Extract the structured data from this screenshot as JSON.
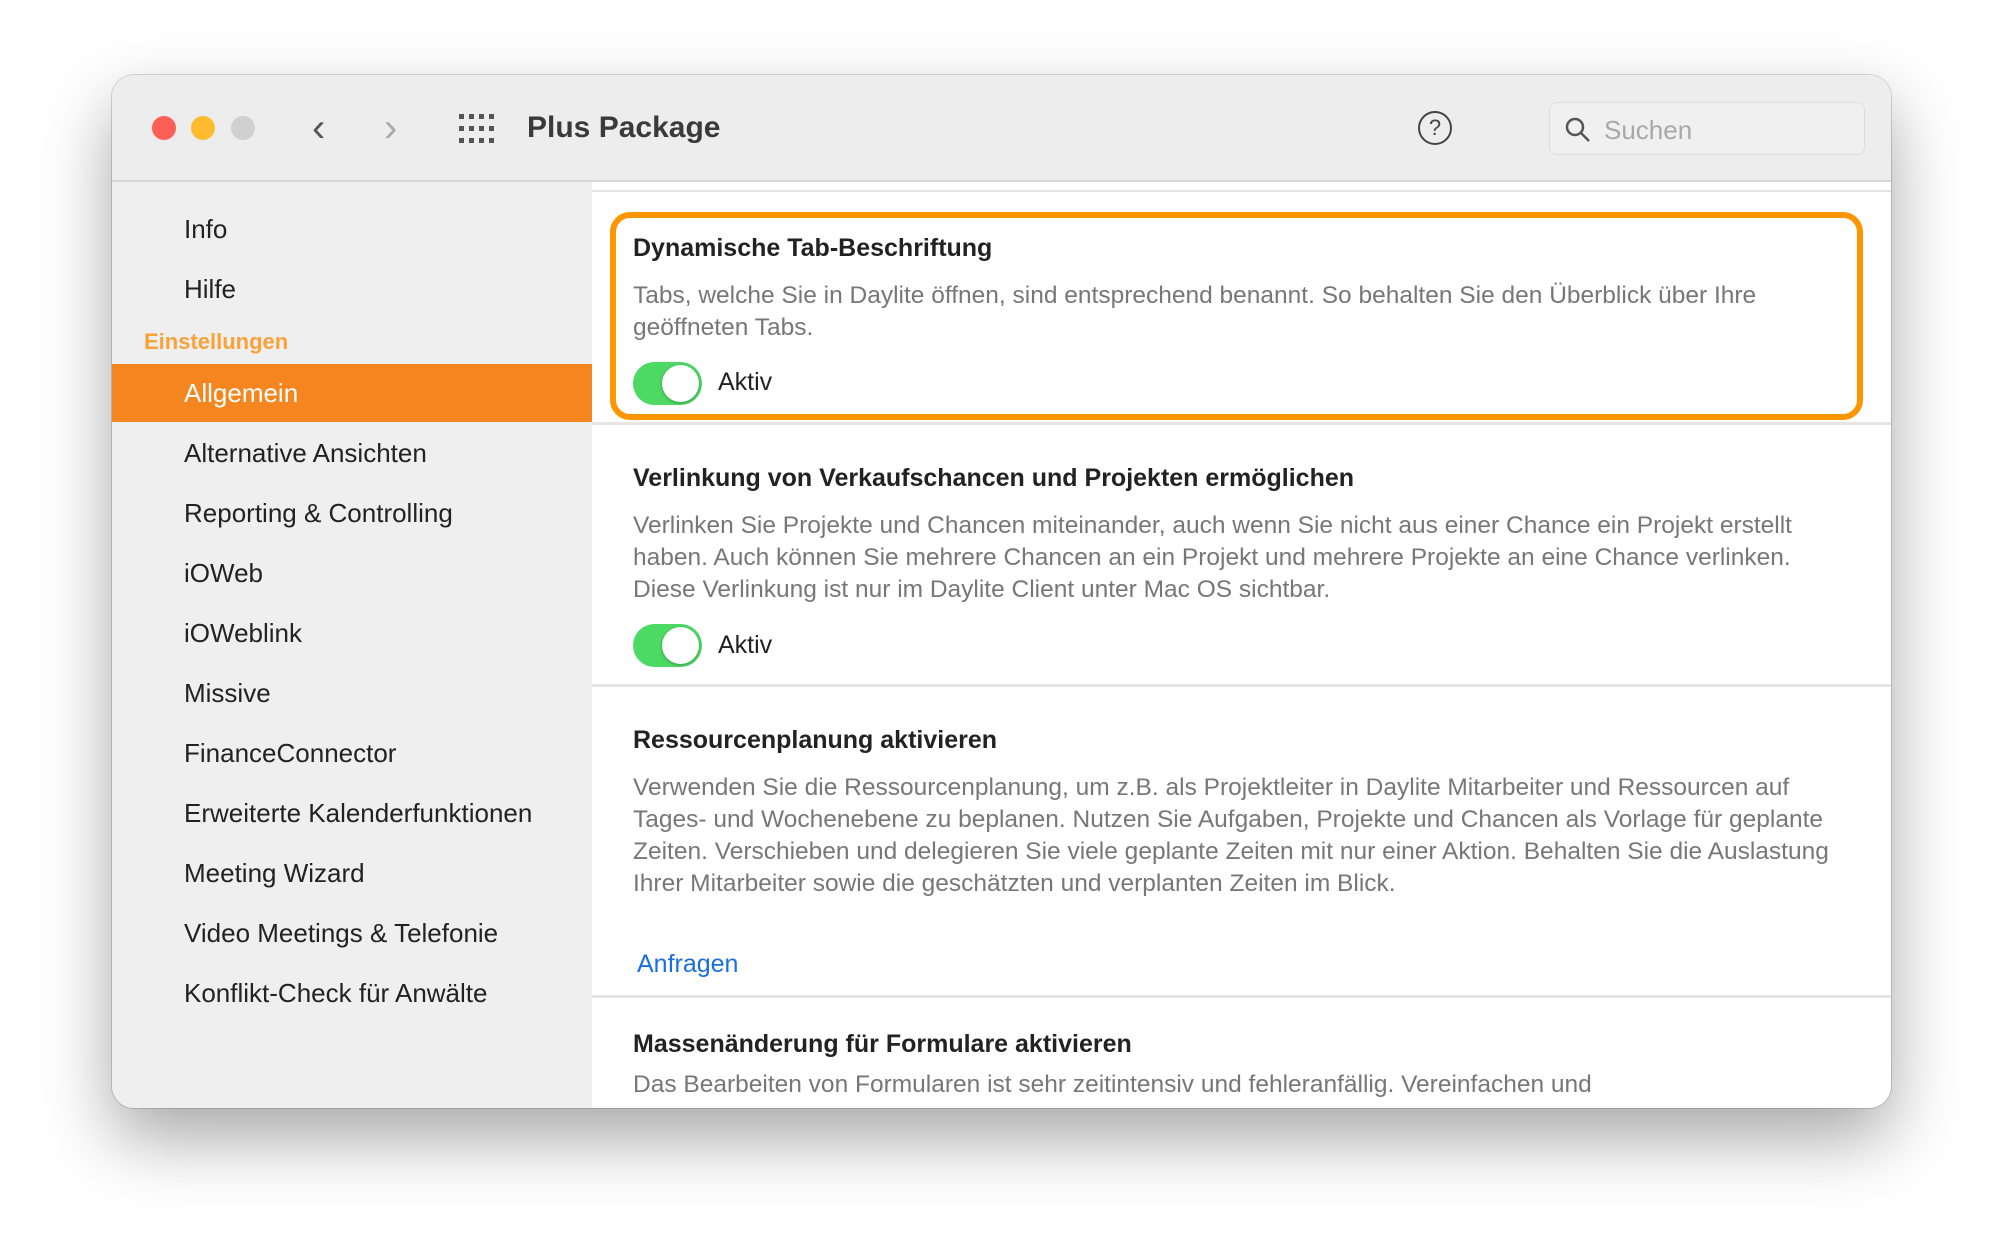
{
  "window": {
    "title": "Plus Package",
    "search_placeholder": "Suchen",
    "traffic_lights": {
      "close": "#fe5f57",
      "minimize": "#febc2e",
      "zoom": "#d0d0d0"
    },
    "icons": [
      "chevron-left-icon",
      "chevron-right-icon",
      "grid-icon",
      "help-icon",
      "search-icon"
    ]
  },
  "sidebar": {
    "top_items": [
      {
        "label": "Info"
      },
      {
        "label": "Hilfe"
      }
    ],
    "section_header": "Einstellungen",
    "items": [
      {
        "label": "Allgemein",
        "active": true
      },
      {
        "label": "Alternative Ansichten"
      },
      {
        "label": "Reporting & Controlling"
      },
      {
        "label": "iOWeb"
      },
      {
        "label": "iOWeblink"
      },
      {
        "label": "Missive"
      },
      {
        "label": "FinanceConnector"
      },
      {
        "label": "Erweiterte Kalenderfunktionen"
      },
      {
        "label": "Meeting Wizard"
      },
      {
        "label": "Video Meetings & Telefonie"
      },
      {
        "label": "Konflikt-Check für Anwälte"
      }
    ],
    "accent_color": "#f5861f"
  },
  "sections": [
    {
      "title": "Dynamische Tab-Beschriftung",
      "description": "Tabs, welche Sie in Daylite öffnen, sind entsprechend benannt. So behalten Sie den Überblick über Ihre geöffneten Tabs.",
      "toggle_label": "Aktiv",
      "enabled": true,
      "highlighted": true
    },
    {
      "title": "Verlinkung von Verkaufschancen und Projekten ermöglichen",
      "description": "Verlinken Sie Projekte und Chancen miteinander, auch wenn Sie nicht aus einer Chance ein Projekt erstellt haben. Auch können Sie mehrere Chancen an ein Projekt und mehrere Projekte an eine Chance verlinken. Diese Verlinkung ist nur im Daylite Client unter Mac OS sichtbar.",
      "toggle_label": "Aktiv",
      "enabled": true
    },
    {
      "title": "Ressourcenplanung aktivieren",
      "description": "Verwenden Sie die Ressourcenplanung, um z.B. als Projektleiter in Daylite Mitarbeiter und Ressourcen auf Tages- und Wochenebene zu beplanen. Nutzen Sie Aufgaben, Projekte und Chancen als Vorlage für geplante Zeiten. Verschieben und delegieren Sie viele geplante Zeiten mit nur einer Aktion. Behalten Sie die Auslastung Ihrer Mitarbeiter sowie die geschätzten und verplanten Zeiten im Blick.",
      "link_label": "Anfragen"
    },
    {
      "title": "Massenänderung für Formulare aktivieren",
      "description": "Das Bearbeiten von Formularen ist sehr zeitintensiv und fehleranfällig. Vereinfachen und"
    }
  ]
}
